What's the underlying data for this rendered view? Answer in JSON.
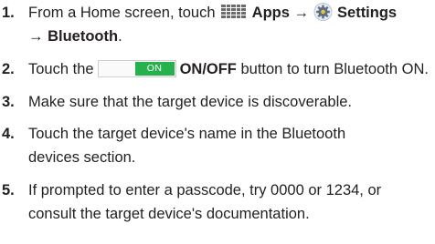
{
  "steps": [
    {
      "number": "1.",
      "line1_pre": "From a Home screen, touch ",
      "apps_label": "Apps",
      "arrow1": "→",
      "settings_label": "Settings",
      "line2": "→ Bluetooth",
      "line2_tail": "."
    },
    {
      "number": "2.",
      "pre": "Touch the",
      "toggle_label": "ON",
      "button_label": "ON/OFF",
      "post": "button to turn Bluetooth ON."
    },
    {
      "number": "3.",
      "text": "Make sure that the target device is discoverable."
    },
    {
      "number": "4.",
      "line1": "Touch the target device's name in the Bluetooth",
      "line2": "devices section."
    },
    {
      "number": "5.",
      "line1": "If prompted to enter a passcode, try 0000 or 1234, or",
      "line2": "consult the target device's documentation."
    }
  ],
  "icons": {
    "apps": "apps-grid-icon",
    "settings": "settings-gear-icon"
  },
  "colors": {
    "text": "#231f20",
    "toggle_on": "#25b14c",
    "icon_gray": "#595959"
  }
}
